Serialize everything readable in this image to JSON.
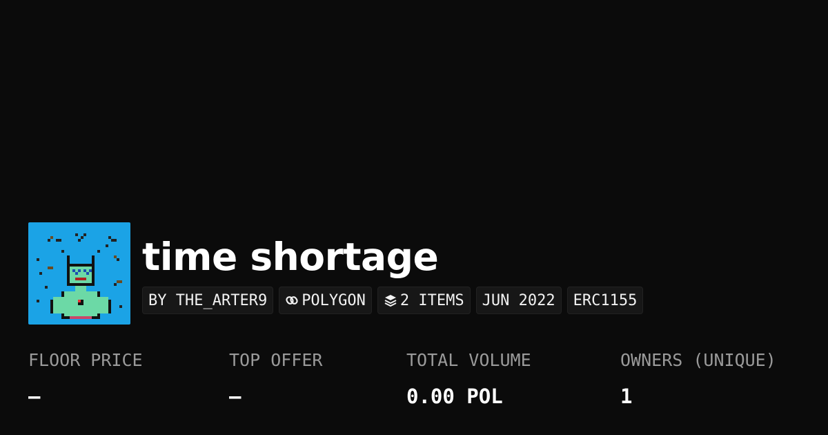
{
  "collection": {
    "title": "time shortage",
    "thumbnail_alt": "pixel art alien on blue background"
  },
  "tags": [
    {
      "label": "BY THE_ARTER9",
      "icon": ""
    },
    {
      "label": "POLYGON",
      "icon": "polygon-chain-icon"
    },
    {
      "label": "2 ITEMS",
      "icon": "layers-icon"
    },
    {
      "label": "JUN 2022",
      "icon": ""
    },
    {
      "label": "ERC1155",
      "icon": ""
    }
  ],
  "stats": [
    {
      "label": "FLOOR PRICE",
      "value": "–"
    },
    {
      "label": "TOP OFFER",
      "value": "–"
    },
    {
      "label": "TOTAL VOLUME",
      "value": "0.00 POL"
    },
    {
      "label": "OWNERS (UNIQUE)",
      "value": "1"
    }
  ],
  "colors": {
    "background": "#0b0b0b",
    "tag_background": "#171717",
    "label_gray": "#9a9a9a",
    "thumbnail_blue": "#1ba3e6",
    "alien_green": "#6cd9a6"
  }
}
